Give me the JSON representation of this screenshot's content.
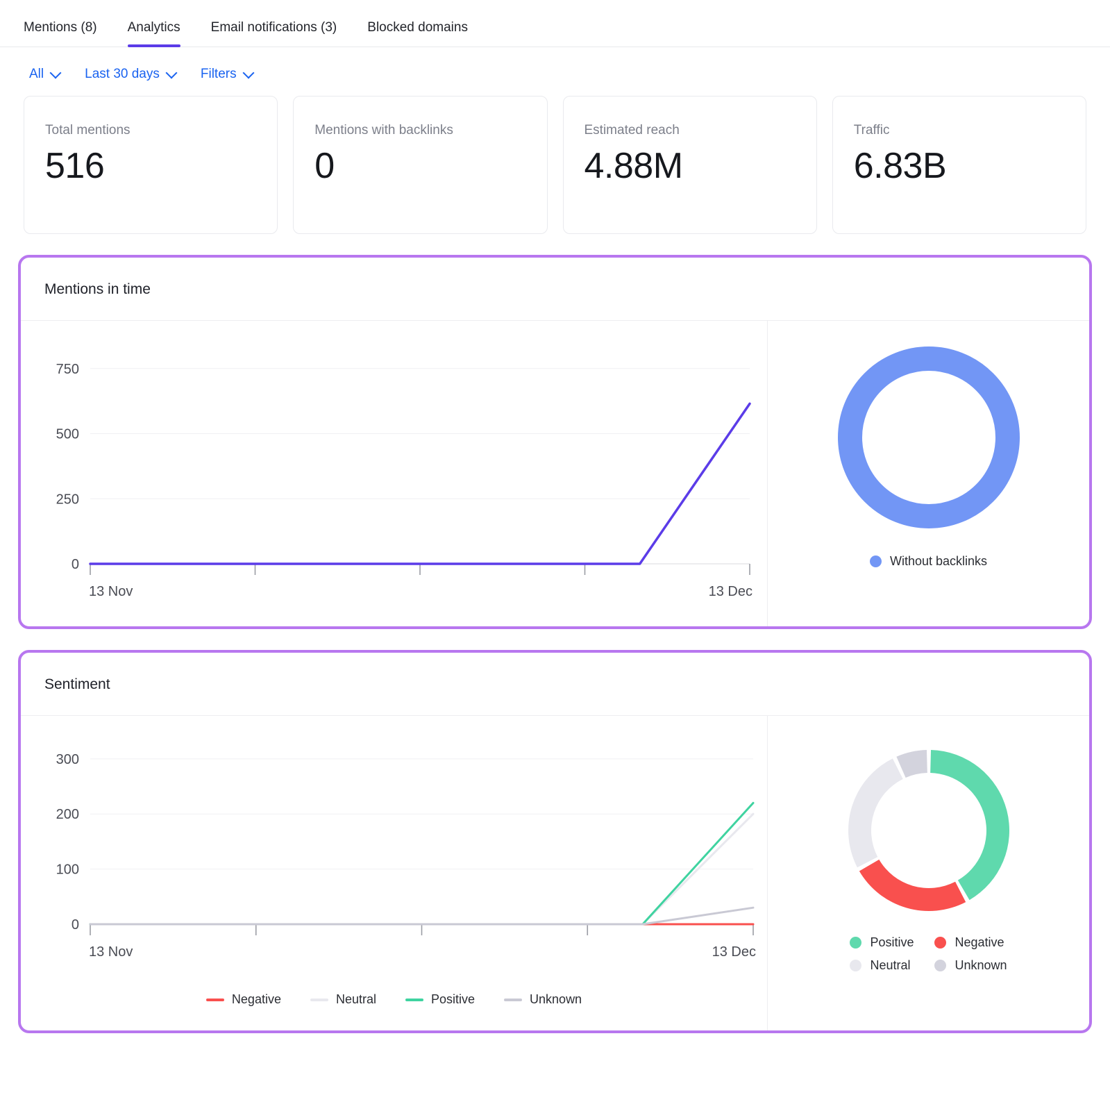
{
  "tabs": [
    {
      "label": "Mentions (8)",
      "active": false
    },
    {
      "label": "Analytics",
      "active": true
    },
    {
      "label": "Email notifications (3)",
      "active": false
    },
    {
      "label": "Blocked domains",
      "active": false
    }
  ],
  "filters": [
    {
      "label": "All",
      "icon": "chevron-down-icon"
    },
    {
      "label": "Last 30 days",
      "icon": "chevron-down-icon"
    },
    {
      "label": "Filters",
      "icon": "chevron-down-icon"
    }
  ],
  "stats": [
    {
      "label": "Total mentions",
      "value": "516"
    },
    {
      "label": "Mentions with backlinks",
      "value": "0"
    },
    {
      "label": "Estimated reach",
      "value": "4.88M"
    },
    {
      "label": "Traffic",
      "value": "6.83B"
    }
  ],
  "colors": {
    "accent_purple": "#5b3ce8",
    "highlight_border": "#b877ef",
    "link_blue": "#1a63f0",
    "donut_blue": "#7296f5",
    "positive_green": "#5fd9ad",
    "negative_red": "#f9504e",
    "neutral_gray": "#e8e8ee",
    "unknown_gray": "#d3d3dd"
  },
  "panels": [
    {
      "title": "Mentions in time",
      "donut_legend": [
        {
          "label": "Without backlinks",
          "color": "#7296f5"
        }
      ]
    },
    {
      "title": "Sentiment",
      "line_legend": [
        {
          "label": "Negative",
          "color": "#f9504e"
        },
        {
          "label": "Neutral",
          "color": "#e8e8ee"
        },
        {
          "label": "Positive",
          "color": "#3fd3a0"
        },
        {
          "label": "Unknown",
          "color": "#d3d3dd"
        }
      ],
      "donut_legend": [
        {
          "label": "Positive",
          "color": "#5fd9ad"
        },
        {
          "label": "Negative",
          "color": "#f9504e"
        },
        {
          "label": "Neutral",
          "color": "#e8e8ee"
        },
        {
          "label": "Unknown",
          "color": "#d3d3dd"
        }
      ]
    }
  ],
  "chart_data": [
    {
      "type": "line",
      "title": "Mentions in time",
      "xlabel": "",
      "ylabel": "",
      "x_tick_labels": [
        "13 Nov",
        "13 Dec"
      ],
      "y_ticks": [
        0,
        250,
        500,
        750
      ],
      "ylim": [
        0,
        800
      ],
      "grid": true,
      "legend_position": "none",
      "series": [
        {
          "name": "Mentions",
          "color": "#5b3ce8",
          "x": [
            "13 Nov",
            "19 Nov",
            "25 Nov",
            "01 Dec",
            "07 Dec",
            "11 Dec",
            "13 Dec"
          ],
          "values": [
            0,
            0,
            0,
            0,
            0,
            0,
            615
          ]
        }
      ]
    },
    {
      "type": "pie",
      "title": "Mentions by backlinks",
      "labels": [
        "Without backlinks"
      ],
      "values": [
        516
      ],
      "percentages": [
        100
      ],
      "colors": [
        "#7296f5"
      ],
      "legend_position": "bottom"
    },
    {
      "type": "line",
      "title": "Sentiment",
      "xlabel": "",
      "ylabel": "",
      "x_tick_labels": [
        "13 Nov",
        "13 Dec"
      ],
      "y_ticks": [
        0,
        100,
        200,
        300
      ],
      "ylim": [
        0,
        330
      ],
      "grid": true,
      "legend_position": "bottom",
      "series": [
        {
          "name": "Negative",
          "color": "#f9504e",
          "x": [
            "13 Nov",
            "19 Nov",
            "25 Nov",
            "01 Dec",
            "07 Dec",
            "11 Dec",
            "13 Dec"
          ],
          "values": [
            0,
            0,
            0,
            0,
            0,
            0,
            0
          ]
        },
        {
          "name": "Neutral",
          "color": "#e8e8ee",
          "x": [
            "13 Nov",
            "19 Nov",
            "25 Nov",
            "01 Dec",
            "07 Dec",
            "11 Dec",
            "13 Dec"
          ],
          "values": [
            0,
            0,
            0,
            0,
            0,
            0,
            200
          ]
        },
        {
          "name": "Positive",
          "color": "#3fd3a0",
          "x": [
            "13 Nov",
            "19 Nov",
            "25 Nov",
            "01 Dec",
            "07 Dec",
            "11 Dec",
            "13 Dec"
          ],
          "values": [
            0,
            0,
            0,
            0,
            0,
            0,
            220
          ]
        },
        {
          "name": "Unknown",
          "color": "#c9c9d4",
          "x": [
            "13 Nov",
            "19 Nov",
            "25 Nov",
            "01 Dec",
            "07 Dec",
            "11 Dec",
            "13 Dec"
          ],
          "values": [
            0,
            0,
            0,
            0,
            0,
            0,
            30
          ]
        }
      ]
    },
    {
      "type": "pie",
      "title": "Sentiment distribution",
      "labels": [
        "Positive",
        "Negative",
        "Neutral",
        "Unknown"
      ],
      "percentages": [
        42,
        25,
        26,
        7
      ],
      "colors": [
        "#5fd9ad",
        "#f9504e",
        "#e8e8ee",
        "#d3d3dd"
      ],
      "legend_position": "bottom"
    }
  ]
}
